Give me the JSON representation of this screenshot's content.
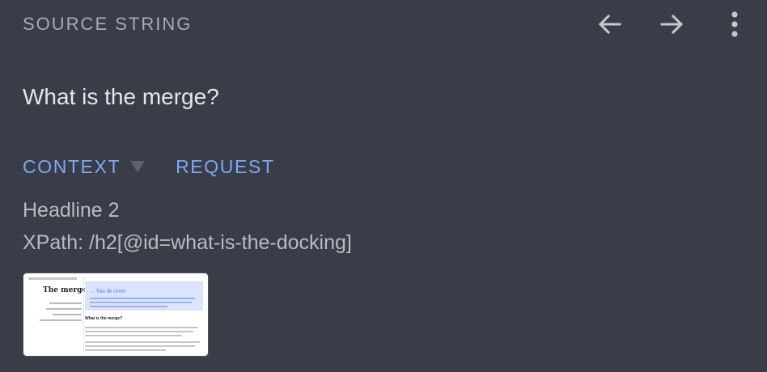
{
  "header": {
    "section_title": "SOURCE STRING",
    "toolbar": [
      {
        "name": "back-arrow-icon",
        "icon": "arrow-left"
      },
      {
        "name": "forward-arrow-icon",
        "icon": "arrow-right"
      },
      {
        "name": "more-vert-icon",
        "icon": "more-vertical"
      }
    ]
  },
  "source": {
    "text": "What is the merge?"
  },
  "tabs": {
    "context_label": "CONTEXT",
    "request_label": "REQUEST"
  },
  "context": {
    "element_type": "Headline 2",
    "xpath": "XPath: /h2[@id=what-is-the-docking]"
  },
  "screenshot_thumbnail": {
    "page_heading": "The merge",
    "hero_title": "→ Tiêu đề chính",
    "section_heading": "What is the merge?"
  },
  "colors": {
    "background": "#393d48",
    "accent": "#7fa8f2",
    "primary_text": "#e4e6ea",
    "secondary_text": "#b8bbc3",
    "icon": "#c5c8cf"
  }
}
